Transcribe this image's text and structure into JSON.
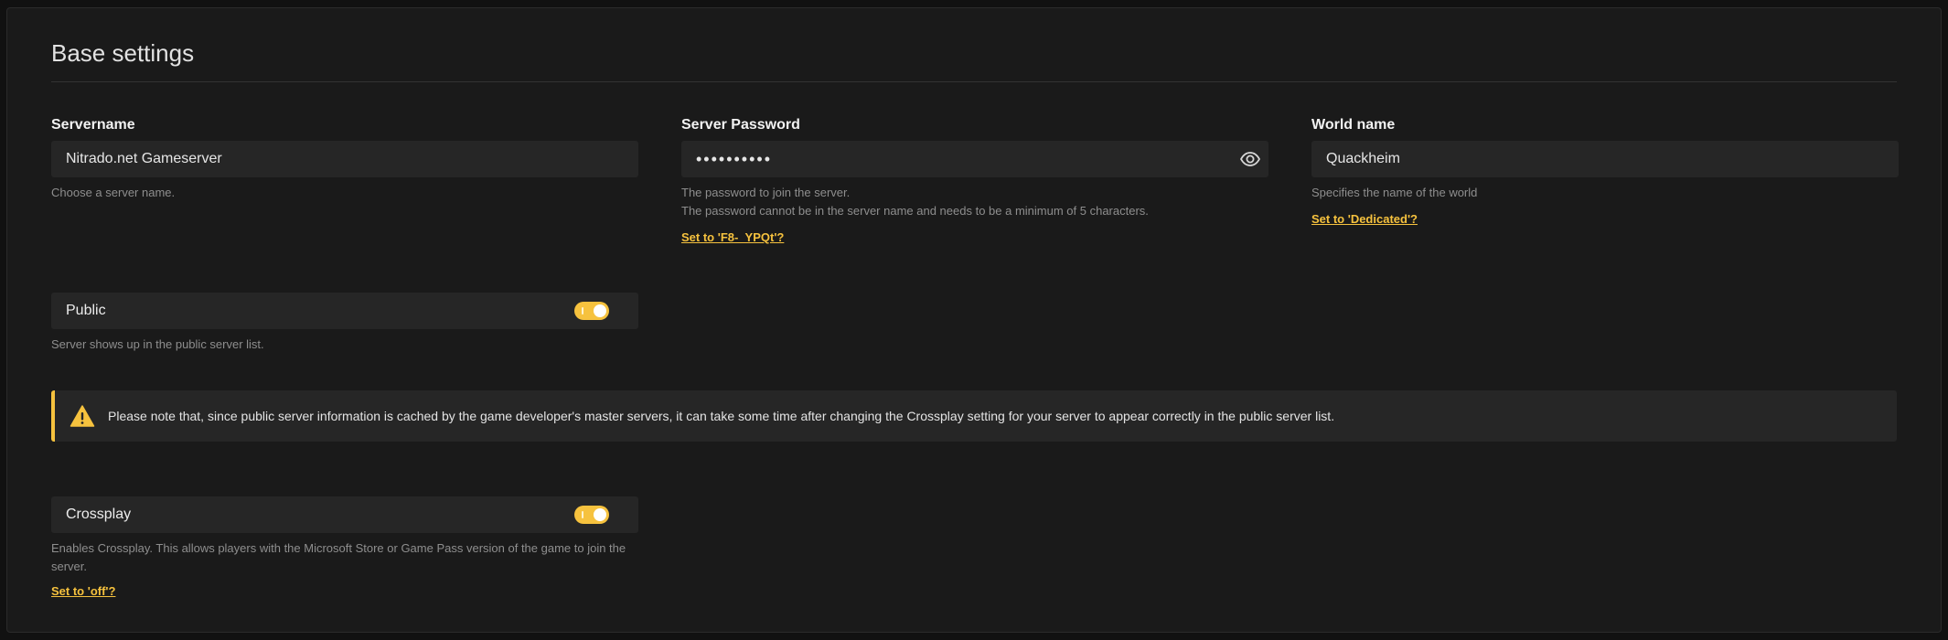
{
  "section": {
    "title": "Base settings"
  },
  "servername": {
    "label": "Servername",
    "value": "Nitrado.net Gameserver",
    "help": "Choose a server name."
  },
  "password": {
    "label": "Server Password",
    "value": "••••••••••",
    "help_lines": [
      "The password to join the server.",
      "The password cannot be in the server name and needs to be a minimum of 5 characters."
    ],
    "suggestion": "Set to 'F8-_YPQt'?",
    "icon": "eye-icon"
  },
  "world_name": {
    "label": "World name",
    "value": "Quackheim",
    "help": "Specifies the name of the world",
    "suggestion": "Set to 'Dedicated'?"
  },
  "public": {
    "label": "Public",
    "enabled": true,
    "help": "Server shows up in the public server list."
  },
  "notice": {
    "icon": "warning-icon",
    "text": "Please note that, since public server information is cached by the game developer's master servers, it can take some time after changing the Crossplay setting for your server to appear correctly in the public server list."
  },
  "crossplay": {
    "label": "Crossplay",
    "enabled": true,
    "help_lines": [
      "Enables Crossplay. This allows players with the Microsoft Store or Game Pass version of the game to join the",
      "server."
    ],
    "suggestion": "Set to 'off'?"
  },
  "colors": {
    "accent": "#f6c23e",
    "panel": "#1a1a1a",
    "input": "#262626",
    "help_text": "#8e8e8e"
  }
}
